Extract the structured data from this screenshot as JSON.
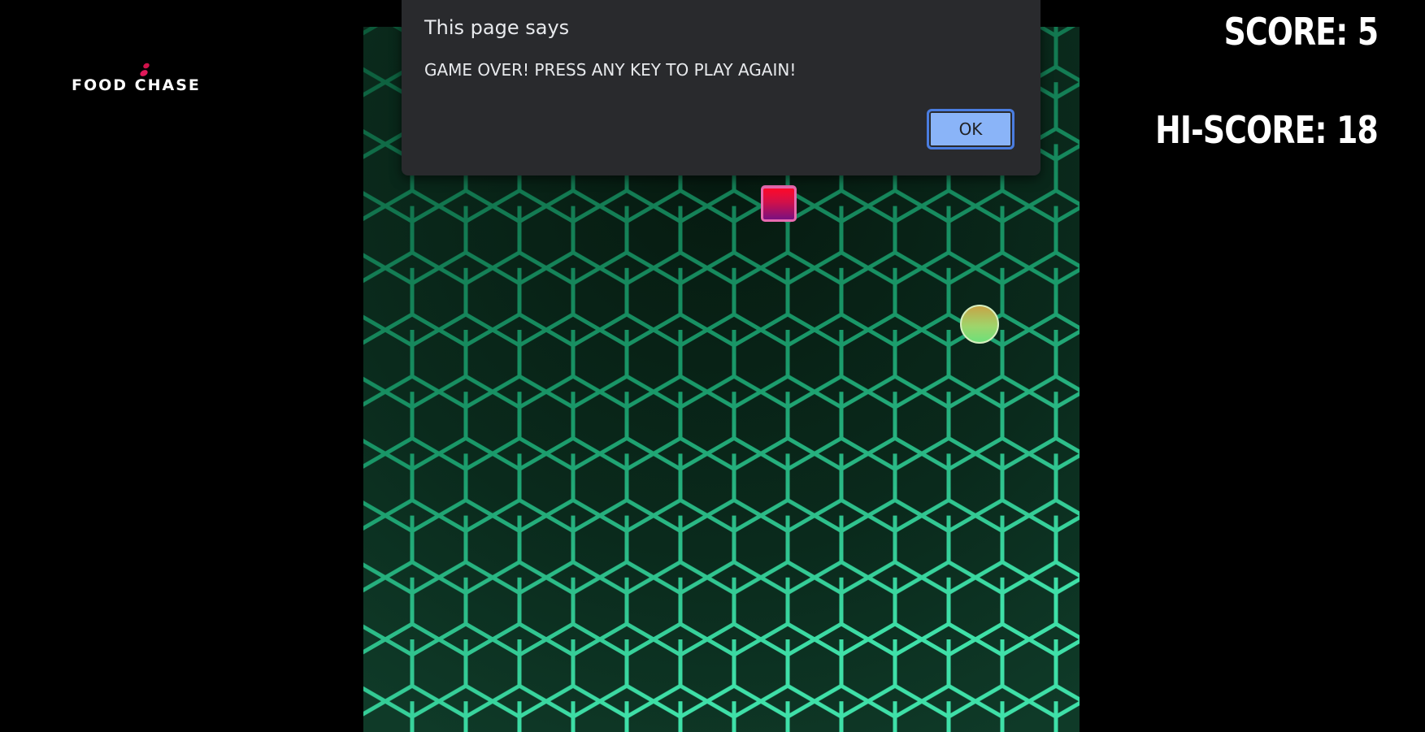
{
  "logo": {
    "text": "FOOD CHASE"
  },
  "scoreboard": {
    "score": "SCORE: 5",
    "hi_score": "HI-SCORE: 18"
  },
  "dialog": {
    "title": "This page says",
    "message": "GAME OVER! PRESS ANY KEY TO PLAY AGAIN!",
    "ok_label": "OK"
  },
  "colors": {
    "board_hex": "#2fe0a0",
    "snake": "#ff0a2a",
    "snake_border": "#e86ab0",
    "food": "#9fd46b",
    "dialog_bg": "#292a2d",
    "button": "#8ab4f8"
  }
}
